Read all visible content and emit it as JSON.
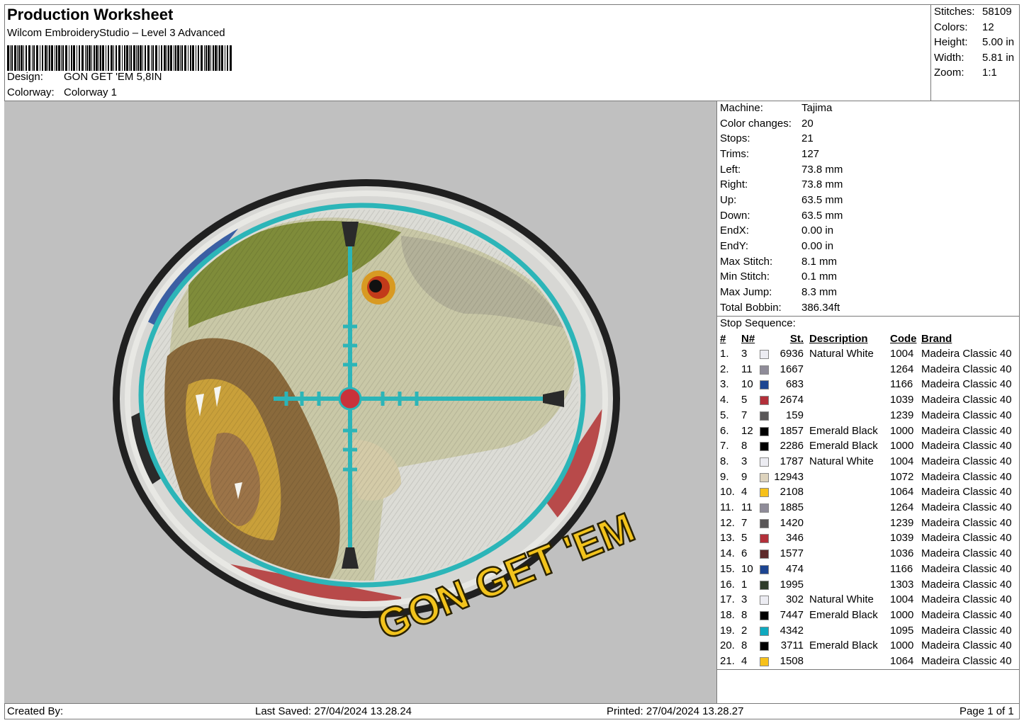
{
  "header": {
    "title": "Production Worksheet",
    "software": "Wilcom EmbroideryStudio – Level 3 Advanced",
    "design_label": "Design:",
    "design_value": "GON GET 'EM 5,8IN",
    "colorway_label": "Colorway:",
    "colorway_value": "Colorway 1"
  },
  "stats": [
    {
      "k": "Stitches:",
      "v": "58109"
    },
    {
      "k": "Colors:",
      "v": "12"
    },
    {
      "k": "Height:",
      "v": "5.00 in"
    },
    {
      "k": "Width:",
      "v": "5.81 in"
    },
    {
      "k": "Zoom:",
      "v": "1:1"
    }
  ],
  "info": [
    {
      "k": "Machine:",
      "v": "Tajima"
    },
    {
      "k": "Color changes:",
      "v": "20"
    },
    {
      "k": "Stops:",
      "v": "21"
    },
    {
      "k": "Trims:",
      "v": "127"
    },
    {
      "k": "Left:",
      "v": "73.8 mm"
    },
    {
      "k": "Right:",
      "v": "73.8 mm"
    },
    {
      "k": "Up:",
      "v": "63.5 mm"
    },
    {
      "k": "Down:",
      "v": "63.5 mm"
    },
    {
      "k": "EndX:",
      "v": "0.00 in"
    },
    {
      "k": "EndY:",
      "v": "0.00 in"
    },
    {
      "k": "Max Stitch:",
      "v": "8.1 mm"
    },
    {
      "k": "Min Stitch:",
      "v": "0.1 mm"
    },
    {
      "k": "Max Jump:",
      "v": "8.3 mm"
    },
    {
      "k": "Total Bobbin:",
      "v": "386.34ft"
    }
  ],
  "stop_sequence": {
    "label": "Stop Sequence:",
    "columns": {
      "idx": "#",
      "n": "N#",
      "st": "St.",
      "desc": "Description",
      "code": "Code",
      "brand": "Brand"
    },
    "rows": [
      {
        "idx": "1.",
        "n": "3",
        "color": "#ececf2",
        "st": "6936",
        "desc": "Natural White",
        "code": "1004",
        "brand": "Madeira Classic 40"
      },
      {
        "idx": "2.",
        "n": "11",
        "color": "#8f8c99",
        "st": "1667",
        "desc": "",
        "code": "1264",
        "brand": "Madeira Classic 40"
      },
      {
        "idx": "3.",
        "n": "10",
        "color": "#1d4591",
        "st": "683",
        "desc": "",
        "code": "1166",
        "brand": "Madeira Classic 40"
      },
      {
        "idx": "4.",
        "n": "5",
        "color": "#b3303a",
        "st": "2674",
        "desc": "",
        "code": "1039",
        "brand": "Madeira Classic 40"
      },
      {
        "idx": "5.",
        "n": "7",
        "color": "#5a5758",
        "st": "159",
        "desc": "",
        "code": "1239",
        "brand": "Madeira Classic 40"
      },
      {
        "idx": "6.",
        "n": "12",
        "color": "#000000",
        "st": "1857",
        "desc": "Emerald Black",
        "code": "1000",
        "brand": "Madeira Classic 40"
      },
      {
        "idx": "7.",
        "n": "8",
        "color": "#000000",
        "st": "2286",
        "desc": "Emerald Black",
        "code": "1000",
        "brand": "Madeira Classic 40"
      },
      {
        "idx": "8.",
        "n": "3",
        "color": "#ececf2",
        "st": "1787",
        "desc": "Natural White",
        "code": "1004",
        "brand": "Madeira Classic 40"
      },
      {
        "idx": "9.",
        "n": "9",
        "color": "#ddd3bd",
        "st": "12943",
        "desc": "",
        "code": "1072",
        "brand": "Madeira Classic 40"
      },
      {
        "idx": "10.",
        "n": "4",
        "color": "#f7c11a",
        "st": "2108",
        "desc": "",
        "code": "1064",
        "brand": "Madeira Classic 40"
      },
      {
        "idx": "11.",
        "n": "11",
        "color": "#8f8c99",
        "st": "1885",
        "desc": "",
        "code": "1264",
        "brand": "Madeira Classic 40"
      },
      {
        "idx": "12.",
        "n": "7",
        "color": "#5a5758",
        "st": "1420",
        "desc": "",
        "code": "1239",
        "brand": "Madeira Classic 40"
      },
      {
        "idx": "13.",
        "n": "5",
        "color": "#b3303a",
        "st": "346",
        "desc": "",
        "code": "1039",
        "brand": "Madeira Classic 40"
      },
      {
        "idx": "14.",
        "n": "6",
        "color": "#5e2a2a",
        "st": "1577",
        "desc": "",
        "code": "1036",
        "brand": "Madeira Classic 40"
      },
      {
        "idx": "15.",
        "n": "10",
        "color": "#1d4591",
        "st": "474",
        "desc": "",
        "code": "1166",
        "brand": "Madeira Classic 40"
      },
      {
        "idx": "16.",
        "n": "1",
        "color": "#2f3b2a",
        "st": "1995",
        "desc": "",
        "code": "1303",
        "brand": "Madeira Classic 40"
      },
      {
        "idx": "17.",
        "n": "3",
        "color": "#ececf2",
        "st": "302",
        "desc": "Natural White",
        "code": "1004",
        "brand": "Madeira Classic 40"
      },
      {
        "idx": "18.",
        "n": "8",
        "color": "#000000",
        "st": "7447",
        "desc": "Emerald Black",
        "code": "1000",
        "brand": "Madeira Classic 40"
      },
      {
        "idx": "19.",
        "n": "2",
        "color": "#0fa9bf",
        "st": "4342",
        "desc": "",
        "code": "1095",
        "brand": "Madeira Classic 40"
      },
      {
        "idx": "20.",
        "n": "8",
        "color": "#000000",
        "st": "3711",
        "desc": "Emerald Black",
        "code": "1000",
        "brand": "Madeira Classic 40"
      },
      {
        "idx": "21.",
        "n": "4",
        "color": "#f7c11a",
        "st": "1508",
        "desc": "",
        "code": "1064",
        "brand": "Madeira Classic 40"
      }
    ]
  },
  "design_text": "GON GET 'EM",
  "footer": {
    "created_by": "Created By:",
    "last_saved": "Last Saved: 27/04/2024 13.28.24",
    "printed": "Printed: 27/04/2024 13.28.27",
    "page": "Page 1 of 1"
  }
}
